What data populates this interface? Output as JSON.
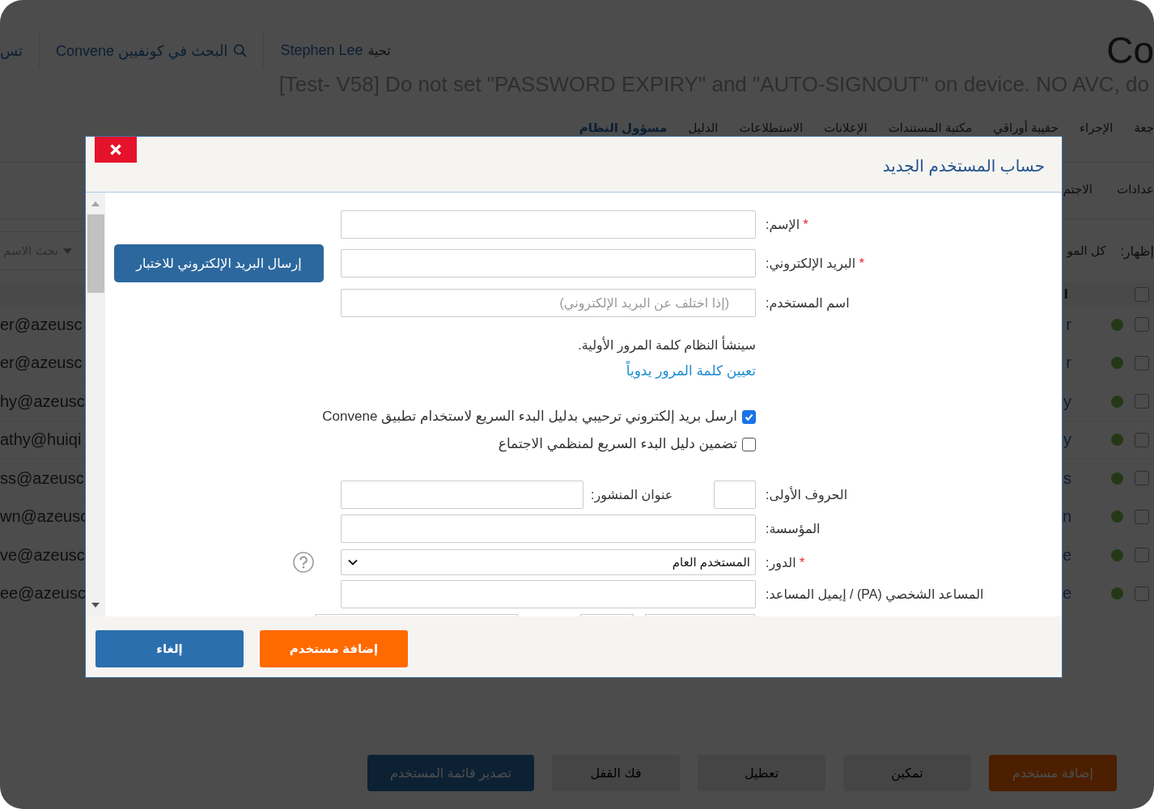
{
  "top_bar": {
    "app_title": "Co",
    "greeting": "تحية",
    "user_name": "Stephen Lee",
    "search_link": "البحث في كونفيين Convene",
    "cut_link": "تس"
  },
  "banner": "[Test- V58] Do not set \"PASSWORD EXPIRY\" and \"AUTO-SIGNOUT\" on device. NO AVC, do",
  "nav": [
    {
      "label": "جعة",
      "selected": false
    },
    {
      "label": "الإجراء",
      "selected": false
    },
    {
      "label": "حقيبة أوراقي",
      "selected": false
    },
    {
      "label": "مكتبة المستندات",
      "selected": false
    },
    {
      "label": "الإعلانات",
      "selected": false
    },
    {
      "label": "الاستطلاعات",
      "selected": false
    },
    {
      "label": "الدليل",
      "selected": false
    },
    {
      "label": "مسؤول النظام",
      "selected": true
    }
  ],
  "sub_tabs": [
    {
      "label": "عدادات",
      "selected": false
    },
    {
      "label": "الاجتم",
      "selected": false
    }
  ],
  "filter": {
    "show_label": "إظهار:",
    "show_value": "كل المو",
    "search_placeholder": "بحث الاسم"
  },
  "table": {
    "header": {
      "checked": false,
      "column_3": "ا"
    },
    "rows": [
      {
        "checked": false,
        "active": true,
        "name": "r",
        "email": "er@azeusc"
      },
      {
        "checked": false,
        "active": true,
        "name": "r",
        "email": "er@azeusc"
      },
      {
        "checked": false,
        "active": true,
        "name": "y",
        "email": "hy@azeusc"
      },
      {
        "checked": false,
        "active": true,
        "name": "y",
        "email": "athy@huiqi"
      },
      {
        "checked": false,
        "active": true,
        "name": "s",
        "email": "ss@azeusc"
      },
      {
        "checked": false,
        "active": true,
        "name": "n",
        "email": "wn@azeusc"
      },
      {
        "checked": false,
        "active": true,
        "name": "e",
        "email": "ve@azeusc"
      },
      {
        "checked": false,
        "active": true,
        "name": "e",
        "email": "ee@azeusc"
      }
    ]
  },
  "bottom_buttons": [
    {
      "label": "إضافة مستخدم",
      "kind": "accent",
      "disabled": false
    },
    {
      "label": "تمكين",
      "kind": "default",
      "disabled": true
    },
    {
      "label": "تعطيل",
      "kind": "default",
      "disabled": true
    },
    {
      "label": "فك القفل",
      "kind": "default",
      "disabled": true
    },
    {
      "label": "تصدير قائمة المستخدم",
      "kind": "primary",
      "disabled": false
    }
  ],
  "modal": {
    "title": "حساب المستخدم الجديد",
    "form": {
      "rows": [
        {
          "kind": "input",
          "label": "الإسم:",
          "required_mark": "*"
        },
        {
          "kind": "input",
          "label": "البريد الإلكتروني:",
          "required_mark": "*",
          "side_button": "إرسال البريد الإلكتروني للاختبار"
        },
        {
          "kind": "input",
          "label": "اسم المستخدم:",
          "placeholder": "(إذا اختلف عن البريد الإلكتروني)"
        },
        {
          "kind": "note",
          "text": "سينشأ النظام كلمة المرور الأولية."
        },
        {
          "kind": "link",
          "text": "تعيين كلمة المرور يدوياً"
        },
        {
          "kind": "checkbox",
          "label": "ارسل بريد إلكتروني ترحيبي بدليل البدء السريع لاستخدام تطبيق Convene",
          "checked": true
        },
        {
          "kind": "checkbox",
          "label": "تضمين دليل البدء السريع لمنظمي الاجتماع",
          "checked": false
        },
        {
          "kind": "pair",
          "label": "الحروف الأولى:",
          "second_label": "عنوان المنشور:"
        },
        {
          "kind": "input",
          "label": "المؤسسة:"
        },
        {
          "kind": "select",
          "label": "الدور:",
          "required_mark": "*",
          "value": "المستخدم العام",
          "help": true
        },
        {
          "kind": "input",
          "label": "المساعد الشخصي (PA) / إيميل المساعد:"
        },
        {
          "kind": "cut_off"
        }
      ]
    },
    "buttons": [
      {
        "label": "إضافة مستخدم",
        "kind": "accent"
      },
      {
        "label": "إلغاء",
        "kind": "primary"
      }
    ]
  }
}
